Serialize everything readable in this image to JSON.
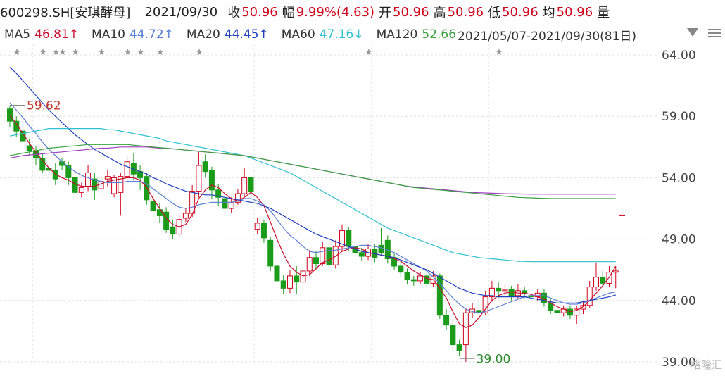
{
  "header": {
    "ticker": "600298.SH[安琪酵母]",
    "date": "2021/09/30",
    "close_label": "收",
    "close_value": "50.96",
    "change_label": "幅",
    "change_value": "9.99%(4.63)",
    "open_label": "开",
    "open_value": "50.96",
    "high_label": "高",
    "high_value": "50.96",
    "low_label": "低",
    "low_value": "50.96",
    "avg_label": "均",
    "avg_value": "50.96",
    "vol_label": "量"
  },
  "ma_bar": {
    "ma5_label": "MA5",
    "ma5_value": "46.81↑",
    "ma10_label": "MA10",
    "ma10_value": "44.72↑",
    "ma20_label": "MA20",
    "ma20_value": "44.45↑",
    "ma60_label": "MA60",
    "ma60_value": "47.16↓",
    "ma120_label": "MA120",
    "ma120_value": "52.66",
    "range_text": "2021/05/07-2021/09/30(81日)"
  },
  "watermark": "格隆汇",
  "colors": {
    "up": "#d0021b",
    "down": "#1a9c1a",
    "ma5": "#c8102e",
    "ma10": "#5a7fd6",
    "ma20": "#1f3fbf",
    "ma60": "#2fc0d0",
    "ma120": "#a040c0",
    "ma250": "#3aa040"
  },
  "chart_data": {
    "type": "candlestick",
    "ylim": [
      39.0,
      64.0
    ],
    "y_ticks": [
      "64.00",
      "59.00",
      "54.00",
      "49.00",
      "44.00",
      "39.00"
    ],
    "annotations": {
      "high_label": "59.62",
      "low_label": "39.00"
    },
    "candles": [
      [
        59.6,
        58.6,
        59.9,
        58.1
      ],
      [
        58.6,
        57.8,
        59.0,
        57.3
      ],
      [
        57.8,
        57.0,
        58.4,
        56.6
      ],
      [
        56.6,
        56.2,
        57.2,
        55.8
      ],
      [
        56.2,
        55.6,
        56.6,
        55.0
      ],
      [
        55.6,
        54.6,
        56.0,
        54.4
      ],
      [
        54.8,
        54.6,
        55.1,
        53.6
      ],
      [
        54.6,
        53.9,
        55.2,
        53.4
      ],
      [
        55.3,
        55.0,
        55.6,
        54.6
      ],
      [
        55.0,
        54.0,
        55.3,
        53.4
      ],
      [
        54.0,
        52.8,
        54.4,
        52.5
      ],
      [
        52.8,
        53.2,
        53.6,
        52.4
      ],
      [
        53.3,
        54.4,
        55.0,
        52.9
      ],
      [
        53.9,
        53.0,
        54.4,
        52.2
      ],
      [
        53.1,
        53.7,
        54.0,
        52.6
      ],
      [
        53.9,
        54.1,
        54.6,
        53.3
      ],
      [
        52.7,
        54.0,
        54.2,
        52.4
      ],
      [
        52.8,
        54.1,
        54.4,
        50.9
      ],
      [
        54.1,
        55.3,
        55.8,
        53.6
      ],
      [
        55.2,
        54.3,
        56.0,
        53.8
      ],
      [
        54.5,
        54.0,
        55.0,
        53.0
      ],
      [
        54.1,
        52.2,
        54.4,
        51.8
      ],
      [
        52.1,
        51.3,
        52.6,
        50.8
      ],
      [
        51.4,
        50.9,
        51.9,
        50.3
      ],
      [
        51.2,
        49.8,
        51.6,
        49.5
      ],
      [
        50.0,
        49.4,
        50.6,
        49.0
      ],
      [
        49.4,
        50.6,
        51.0,
        49.2
      ],
      [
        50.7,
        51.1,
        51.5,
        50.4
      ],
      [
        51.1,
        52.9,
        53.4,
        50.8
      ],
      [
        52.9,
        55.0,
        56.1,
        52.4
      ],
      [
        55.3,
        54.5,
        55.9,
        54.0
      ],
      [
        54.6,
        53.0,
        54.9,
        52.3
      ],
      [
        53.0,
        52.4,
        53.5,
        51.7
      ],
      [
        52.3,
        51.5,
        52.6,
        50.9
      ],
      [
        51.5,
        52.0,
        52.4,
        51.1
      ],
      [
        52.0,
        52.7,
        53.1,
        51.8
      ],
      [
        52.7,
        54.0,
        54.8,
        52.5
      ],
      [
        54.0,
        52.9,
        54.3,
        52.4
      ],
      [
        49.8,
        50.3,
        50.7,
        49.4
      ],
      [
        50.3,
        49.1,
        50.6,
        48.7
      ],
      [
        48.9,
        46.8,
        49.2,
        46.4
      ],
      [
        46.8,
        45.6,
        47.2,
        45.1
      ],
      [
        45.6,
        45.0,
        46.1,
        44.5
      ],
      [
        45.0,
        46.0,
        46.5,
        44.6
      ],
      [
        46.0,
        45.5,
        46.8,
        44.5
      ],
      [
        45.5,
        46.4,
        47.2,
        44.8
      ],
      [
        46.4,
        47.5,
        48.1,
        46.0
      ],
      [
        47.5,
        47.0,
        48.0,
        46.5
      ],
      [
        47.0,
        48.3,
        48.8,
        46.8
      ],
      [
        48.3,
        46.9,
        48.9,
        46.4
      ],
      [
        46.9,
        48.4,
        48.9,
        46.6
      ],
      [
        48.4,
        49.7,
        50.2,
        48.0
      ],
      [
        49.7,
        48.4,
        50.0,
        48.0
      ],
      [
        48.4,
        47.9,
        48.8,
        47.5
      ],
      [
        47.9,
        47.6,
        48.3,
        47.2
      ],
      [
        47.6,
        48.2,
        48.6,
        47.3
      ],
      [
        48.2,
        47.5,
        48.6,
        47.1
      ],
      [
        48.5,
        47.9,
        49.9,
        47.6
      ],
      [
        48.9,
        47.4,
        49.3,
        47.0
      ],
      [
        47.5,
        46.8,
        47.9,
        46.5
      ],
      [
        46.8,
        46.3,
        47.2,
        45.9
      ],
      [
        46.3,
        45.7,
        46.6,
        45.3
      ],
      [
        45.7,
        45.6,
        46.0,
        45.2
      ],
      [
        45.6,
        46.0,
        46.3,
        45.3
      ],
      [
        46.0,
        45.4,
        46.4,
        45.0
      ],
      [
        45.4,
        46.0,
        46.4,
        45.1
      ],
      [
        46.0,
        42.8,
        46.2,
        42.5
      ],
      [
        42.8,
        42.0,
        43.3,
        41.6
      ],
      [
        42.0,
        40.4,
        42.5,
        40.0
      ],
      [
        40.4,
        39.9,
        40.8,
        39.5
      ],
      [
        40.4,
        43.0,
        43.4,
        39.0
      ],
      [
        43.0,
        43.3,
        43.8,
        42.6
      ],
      [
        43.2,
        43.0,
        44.0,
        42.8
      ],
      [
        43.0,
        44.3,
        44.8,
        42.8
      ],
      [
        44.3,
        45.0,
        45.6,
        43.9
      ],
      [
        45.0,
        44.8,
        45.5,
        44.2
      ],
      [
        44.8,
        44.9,
        45.3,
        44.3
      ],
      [
        44.9,
        44.4,
        45.2,
        44.0
      ],
      [
        44.4,
        44.8,
        45.3,
        44.1
      ],
      [
        44.8,
        44.6,
        45.1,
        44.2
      ],
      [
        44.4,
        44.3,
        44.6,
        44.0
      ],
      [
        44.3,
        44.6,
        44.9,
        44.0
      ],
      [
        44.6,
        43.8,
        44.9,
        43.5
      ],
      [
        43.8,
        43.2,
        44.1,
        42.9
      ],
      [
        43.2,
        43.0,
        43.5,
        42.6
      ],
      [
        43.0,
        43.3,
        43.6,
        42.7
      ],
      [
        43.3,
        42.8,
        43.6,
        42.5
      ],
      [
        42.8,
        43.3,
        43.6,
        42.1
      ],
      [
        43.3,
        43.6,
        44.0,
        42.9
      ],
      [
        43.6,
        45.1,
        45.6,
        43.4
      ],
      [
        45.1,
        45.9,
        47.1,
        44.8
      ],
      [
        45.9,
        45.4,
        46.4,
        45.0
      ],
      [
        45.4,
        46.3,
        46.8,
        45.1
      ],
      [
        46.3,
        46.4,
        46.8,
        45.0
      ],
      [
        50.96,
        50.96,
        50.96,
        50.96
      ]
    ],
    "series": [
      {
        "name": "MA5",
        "values": [
          59.1,
          58.4,
          57.6,
          56.8,
          56.1,
          55.4,
          54.8,
          54.3,
          54.0,
          53.8,
          53.5,
          53.3,
          53.3,
          53.3,
          53.5,
          53.7,
          53.8,
          53.9,
          54.0,
          54.0,
          53.8,
          53.2,
          52.3,
          51.5,
          50.7,
          50.2,
          50.0,
          50.2,
          51.0,
          52.3,
          53.0,
          53.4,
          53.2,
          52.7,
          52.3,
          52.1,
          52.4,
          52.8,
          52.4,
          51.7,
          50.4,
          49.0,
          47.8,
          46.8,
          46.3,
          46.0,
          46.1,
          46.6,
          47.1,
          47.3,
          47.6,
          48.0,
          48.2,
          48.3,
          48.2,
          47.9,
          47.8,
          47.7,
          47.6,
          47.4,
          47.2,
          46.8,
          46.4,
          46.1,
          45.8,
          45.7,
          45.0,
          44.2,
          43.1,
          42.1,
          41.8,
          42.0,
          42.6,
          43.3,
          44.0,
          44.4,
          44.6,
          44.7,
          44.6,
          44.6,
          44.5,
          44.3,
          44.1,
          43.8,
          43.5,
          43.3,
          43.1,
          43.2,
          43.5,
          44.0,
          44.6,
          45.2,
          45.9,
          46.8
        ]
      },
      {
        "name": "MA10",
        "values": [
          60.1,
          59.5,
          58.9,
          58.2,
          57.6,
          56.9,
          56.3,
          55.8,
          55.3,
          54.9,
          54.5,
          54.2,
          54.0,
          53.8,
          53.7,
          53.6,
          53.6,
          53.6,
          53.7,
          53.7,
          53.7,
          53.5,
          53.1,
          52.7,
          52.3,
          51.9,
          51.6,
          51.5,
          51.6,
          51.8,
          51.9,
          52.0,
          52.0,
          52.0,
          52.0,
          52.1,
          52.3,
          52.3,
          52.1,
          51.8,
          51.3,
          50.6,
          49.9,
          49.3,
          48.9,
          48.4,
          48.0,
          47.9,
          48.0,
          48.1,
          48.1,
          48.2,
          48.3,
          48.4,
          48.5,
          48.5,
          48.4,
          48.3,
          48.1,
          47.9,
          47.6,
          47.3,
          47.0,
          46.7,
          46.4,
          45.9,
          45.4,
          44.8,
          44.2,
          43.7,
          43.3,
          43.1,
          43.0,
          43.1,
          43.3,
          43.5,
          43.7,
          43.9,
          44.1,
          44.3,
          44.4,
          44.4,
          44.4,
          44.2,
          44.0,
          43.8,
          43.7,
          43.7,
          43.8,
          44.0,
          44.2,
          44.4,
          44.6,
          44.7
        ]
      },
      {
        "name": "MA20",
        "values": [
          63.0,
          62.5,
          61.9,
          61.3,
          60.7,
          60.1,
          59.5,
          59.0,
          58.5,
          58.0,
          57.5,
          57.1,
          56.7,
          56.3,
          56.0,
          55.7,
          55.4,
          55.1,
          54.9,
          54.7,
          54.5,
          54.3,
          54.0,
          53.8,
          53.5,
          53.3,
          53.1,
          52.9,
          52.8,
          52.7,
          52.6,
          52.6,
          52.5,
          52.4,
          52.3,
          52.2,
          52.1,
          52.0,
          51.9,
          51.7,
          51.5,
          51.2,
          50.9,
          50.6,
          50.3,
          50.0,
          49.7,
          49.4,
          49.2,
          49.0,
          48.8,
          48.6,
          48.4,
          48.2,
          48.0,
          47.9,
          47.8,
          47.7,
          47.6,
          47.5,
          47.3,
          47.1,
          46.9,
          46.7,
          46.5,
          46.2,
          45.9,
          45.6,
          45.3,
          45.0,
          44.8,
          44.6,
          44.5,
          44.4,
          44.4,
          44.3,
          44.3,
          44.3,
          44.3,
          44.3,
          44.2,
          44.1,
          44.0,
          43.9,
          43.8,
          43.8,
          43.8,
          43.8,
          43.9,
          44.0,
          44.1,
          44.2,
          44.3,
          44.45
        ]
      },
      {
        "name": "MA60",
        "values": [
          57.4,
          57.5,
          57.6,
          57.7,
          57.8,
          57.9,
          58.0,
          58.0,
          58.0,
          58.0,
          58.0,
          58.0,
          58.0,
          58.0,
          58.0,
          57.9,
          57.9,
          57.8,
          57.7,
          57.6,
          57.5,
          57.4,
          57.3,
          57.2,
          57.0,
          56.9,
          56.8,
          56.7,
          56.6,
          56.5,
          56.4,
          56.3,
          56.2,
          56.1,
          56.0,
          55.9,
          55.8,
          55.6,
          55.4,
          55.2,
          55.0,
          54.8,
          54.6,
          54.4,
          54.1,
          53.8,
          53.5,
          53.2,
          52.9,
          52.6,
          52.3,
          52.0,
          51.7,
          51.4,
          51.1,
          50.8,
          50.5,
          50.2,
          49.9,
          49.7,
          49.5,
          49.3,
          49.1,
          48.9,
          48.7,
          48.5,
          48.3,
          48.1,
          47.9,
          47.8,
          47.7,
          47.6,
          47.5,
          47.45,
          47.4,
          47.35,
          47.3,
          47.25,
          47.2,
          47.18,
          47.16,
          47.16,
          47.16,
          47.16,
          47.16,
          47.16,
          47.16,
          47.16,
          47.16,
          47.16,
          47.16,
          47.16,
          47.16,
          47.16
        ]
      },
      {
        "name": "MA120",
        "values": [
          55.6,
          55.7,
          55.8,
          55.85,
          55.9,
          55.95,
          56.0,
          56.05,
          56.1,
          56.15,
          56.2,
          56.25,
          56.3,
          56.35,
          56.4,
          56.4,
          56.45,
          56.5,
          56.5,
          56.5,
          56.5,
          56.5,
          56.45,
          56.4,
          56.4,
          56.35,
          56.3,
          56.25,
          56.2,
          56.15,
          56.1,
          56.05,
          56.0,
          55.95,
          55.9,
          55.85,
          55.8,
          55.7,
          55.6,
          55.5,
          55.4,
          55.3,
          55.2,
          55.1,
          55.0,
          54.9,
          54.8,
          54.7,
          54.6,
          54.5,
          54.4,
          54.3,
          54.2,
          54.1,
          54.0,
          53.9,
          53.8,
          53.7,
          53.6,
          53.5,
          53.4,
          53.3,
          53.25,
          53.2,
          53.15,
          53.1,
          53.05,
          53.0,
          52.95,
          52.9,
          52.85,
          52.8,
          52.78,
          52.76,
          52.74,
          52.72,
          52.7,
          52.69,
          52.68,
          52.67,
          52.66,
          52.66,
          52.66,
          52.66,
          52.66,
          52.66,
          52.66,
          52.66,
          52.66,
          52.66,
          52.66,
          52.66,
          52.66,
          52.66
        ]
      },
      {
        "name": "MA250",
        "values": [
          55.8,
          55.9,
          56.0,
          56.1,
          56.2,
          56.3,
          56.4,
          56.45,
          56.5,
          56.55,
          56.6,
          56.65,
          56.7,
          56.7,
          56.7,
          56.7,
          56.7,
          56.7,
          56.7,
          56.65,
          56.6,
          56.55,
          56.5,
          56.45,
          56.4,
          56.35,
          56.3,
          56.25,
          56.2,
          56.15,
          56.1,
          56.05,
          56.0,
          55.95,
          55.9,
          55.85,
          55.8,
          55.7,
          55.6,
          55.5,
          55.4,
          55.3,
          55.2,
          55.1,
          55.0,
          54.9,
          54.8,
          54.7,
          54.6,
          54.5,
          54.4,
          54.3,
          54.2,
          54.1,
          54.0,
          53.9,
          53.8,
          53.7,
          53.6,
          53.5,
          53.4,
          53.3,
          53.2,
          53.15,
          53.1,
          53.05,
          53.0,
          52.95,
          52.9,
          52.85,
          52.8,
          52.75,
          52.7,
          52.65,
          52.6,
          52.55,
          52.5,
          52.45,
          52.4,
          52.38,
          52.36,
          52.34,
          52.32,
          52.3,
          52.3,
          52.3,
          52.3,
          52.3,
          52.3,
          52.3,
          52.3,
          52.3,
          52.3,
          52.3
        ]
      }
    ]
  }
}
